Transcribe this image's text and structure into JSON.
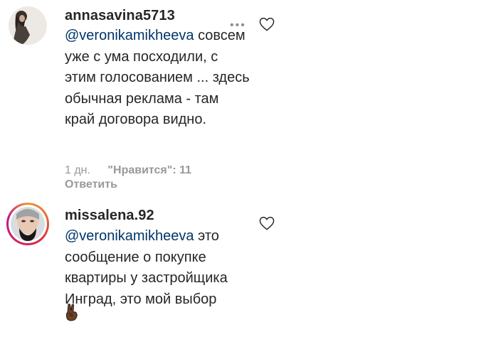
{
  "comments": [
    {
      "username": "annasavina5713",
      "mention": "@veronikamikheeva",
      "text": "совсем уже с ума посходили, с этим голосованием ... здесь обычная реклама - там край договора видно.",
      "time": "1 дн.",
      "likes": "\"Нравится\": 11",
      "reply": "Ответить",
      "more_icon": "more-dots-icon",
      "like_icon": "heart-icon"
    },
    {
      "username": "missalena.92",
      "mention": "@veronikamikheeva",
      "text": " это сообщение о покупке квартиры у застройщика Инград, это мой выбор",
      "emoji_icon": "victory-hand-icon",
      "like_icon": "heart-icon"
    }
  ],
  "colors": {
    "text": "#262626",
    "mention": "#003569",
    "meta": "#999999",
    "story_ring_start": "#f09433",
    "story_ring_end": "#bc1888"
  }
}
